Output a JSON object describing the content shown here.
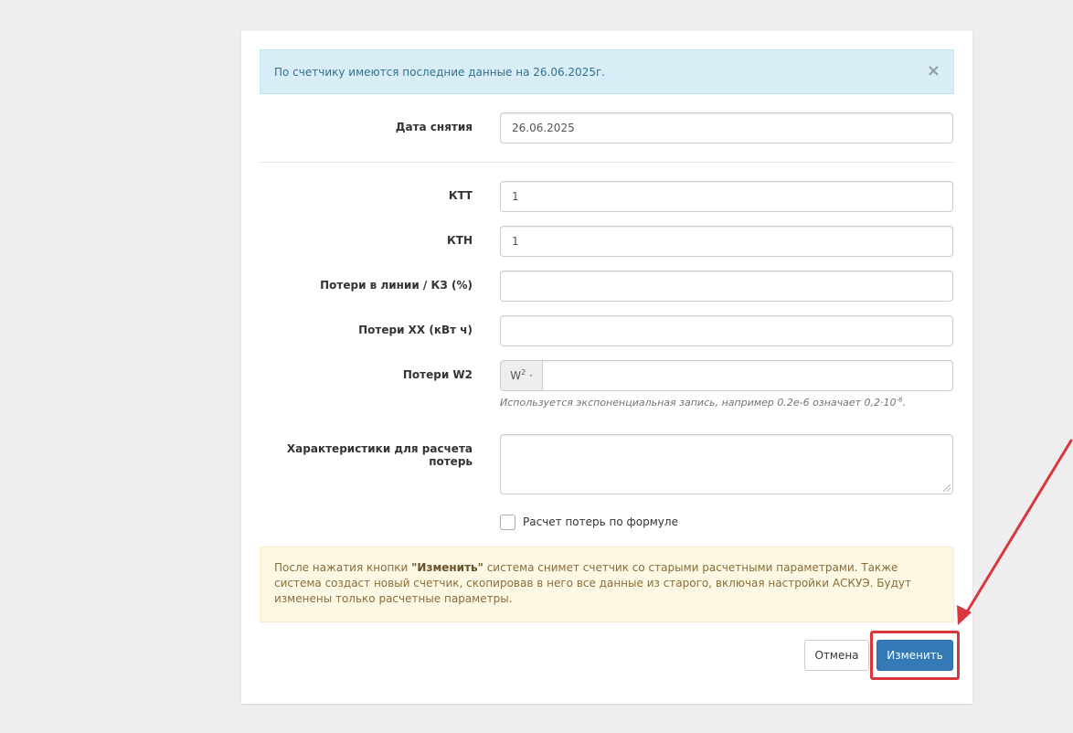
{
  "info_alert": {
    "text": "По счетчику имеются последние данные на 26.06.2025г.",
    "close": "×"
  },
  "form": {
    "date": {
      "label": "Дата снятия",
      "value": "26.06.2025"
    },
    "ktt": {
      "label": "КТТ",
      "value": "1"
    },
    "ktn": {
      "label": "КТН",
      "value": "1"
    },
    "line_losses": {
      "label": "Потери в линии / КЗ (%)",
      "value": ""
    },
    "xx_losses": {
      "label": "Потери ХХ (кВт ч)",
      "value": ""
    },
    "w2_losses": {
      "label": "Потери W2",
      "addon_base": "W",
      "addon_exp": "2",
      "addon_suffix": " ·",
      "value": "",
      "help_prefix": "Используется экспоненциальная запись, например 0.2e-6 означает 0,2·10",
      "help_exp": "-6",
      "help_suffix": "."
    },
    "characteristics": {
      "label": "Характеристики для расчета потерь",
      "value": ""
    },
    "formula_checkbox": {
      "label": "Расчет потерь по формуле",
      "checked": false
    }
  },
  "warning_alert": {
    "prefix": "После нажатия кнопки ",
    "bold": "\"Изменить\"",
    "suffix": " система снимет счетчик со старыми расчетными параметрами. Также система создаст новый счетчик, скопировав в него все данные из старого, включая настройки АСКУЭ. Будут изменены только расчетные параметры."
  },
  "buttons": {
    "cancel": "Отмена",
    "submit": "Изменить"
  },
  "colors": {
    "primary": "#337ab7",
    "info_bg": "#d9edf7",
    "warning_bg": "#fcf8e3",
    "annotation": "#d9363e"
  }
}
